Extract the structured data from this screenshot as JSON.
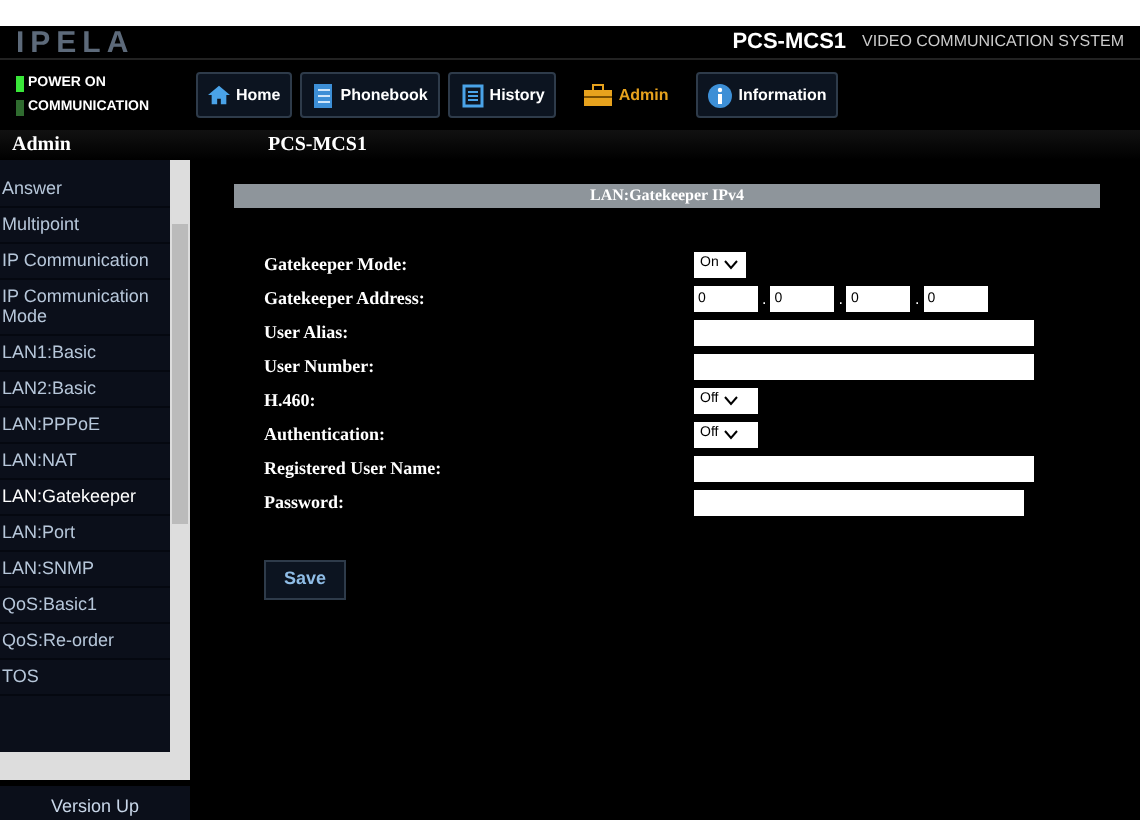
{
  "header": {
    "logo": "IPELA",
    "model": "PCS-MCS1",
    "tagline": "VIDEO COMMUNICATION SYSTEM"
  },
  "indicators": [
    {
      "label": "POWER ON",
      "on": true
    },
    {
      "label": "COMMUNICATION",
      "on": false
    }
  ],
  "nav": [
    {
      "label": "Home",
      "kind": "home",
      "selected": false
    },
    {
      "label": "Phonebook",
      "kind": "book",
      "selected": false
    },
    {
      "label": "History",
      "kind": "history",
      "selected": false
    },
    {
      "label": "Admin",
      "kind": "toolbox",
      "selected": true
    },
    {
      "label": "Information",
      "kind": "info",
      "selected": false
    }
  ],
  "breadcrumb": {
    "section": "Admin",
    "device": "PCS-MCS1"
  },
  "sidebar": {
    "items": [
      {
        "label": "Answer",
        "selected": false
      },
      {
        "label": "Multipoint",
        "selected": false
      },
      {
        "label": "IP Communication",
        "selected": false
      },
      {
        "label": "IP Communication Mode",
        "selected": false
      },
      {
        "label": "LAN1:Basic",
        "selected": false
      },
      {
        "label": "LAN2:Basic",
        "selected": false
      },
      {
        "label": "LAN:PPPoE",
        "selected": false
      },
      {
        "label": "LAN:NAT",
        "selected": false
      },
      {
        "label": "LAN:Gatekeeper",
        "selected": true
      },
      {
        "label": "LAN:Port",
        "selected": false
      },
      {
        "label": "LAN:SNMP",
        "selected": false
      },
      {
        "label": "QoS:Basic1",
        "selected": false
      },
      {
        "label": "QoS:Re-order",
        "selected": false
      },
      {
        "label": "TOS",
        "selected": false
      }
    ],
    "footer": "Version Up"
  },
  "panel": {
    "title": "LAN:Gatekeeper IPv4",
    "fields": [
      {
        "label": "Gatekeeper Mode:",
        "kind": "select",
        "value": "On"
      },
      {
        "label": "Gatekeeper Address:",
        "kind": "ip",
        "octets": [
          "0",
          "0",
          "0",
          "0"
        ],
        "separators": [
          ".",
          ".",
          "."
        ]
      },
      {
        "label": "User Alias:",
        "kind": "text"
      },
      {
        "label": "User Number:",
        "kind": "text"
      },
      {
        "label": "H.460:",
        "kind": "select",
        "value": "Off"
      },
      {
        "label": "Authentication:",
        "kind": "select",
        "value": "Off"
      },
      {
        "label": "Registered User Name:",
        "kind": "text"
      },
      {
        "label": "Password:",
        "kind": "password"
      }
    ],
    "save": "Save"
  }
}
